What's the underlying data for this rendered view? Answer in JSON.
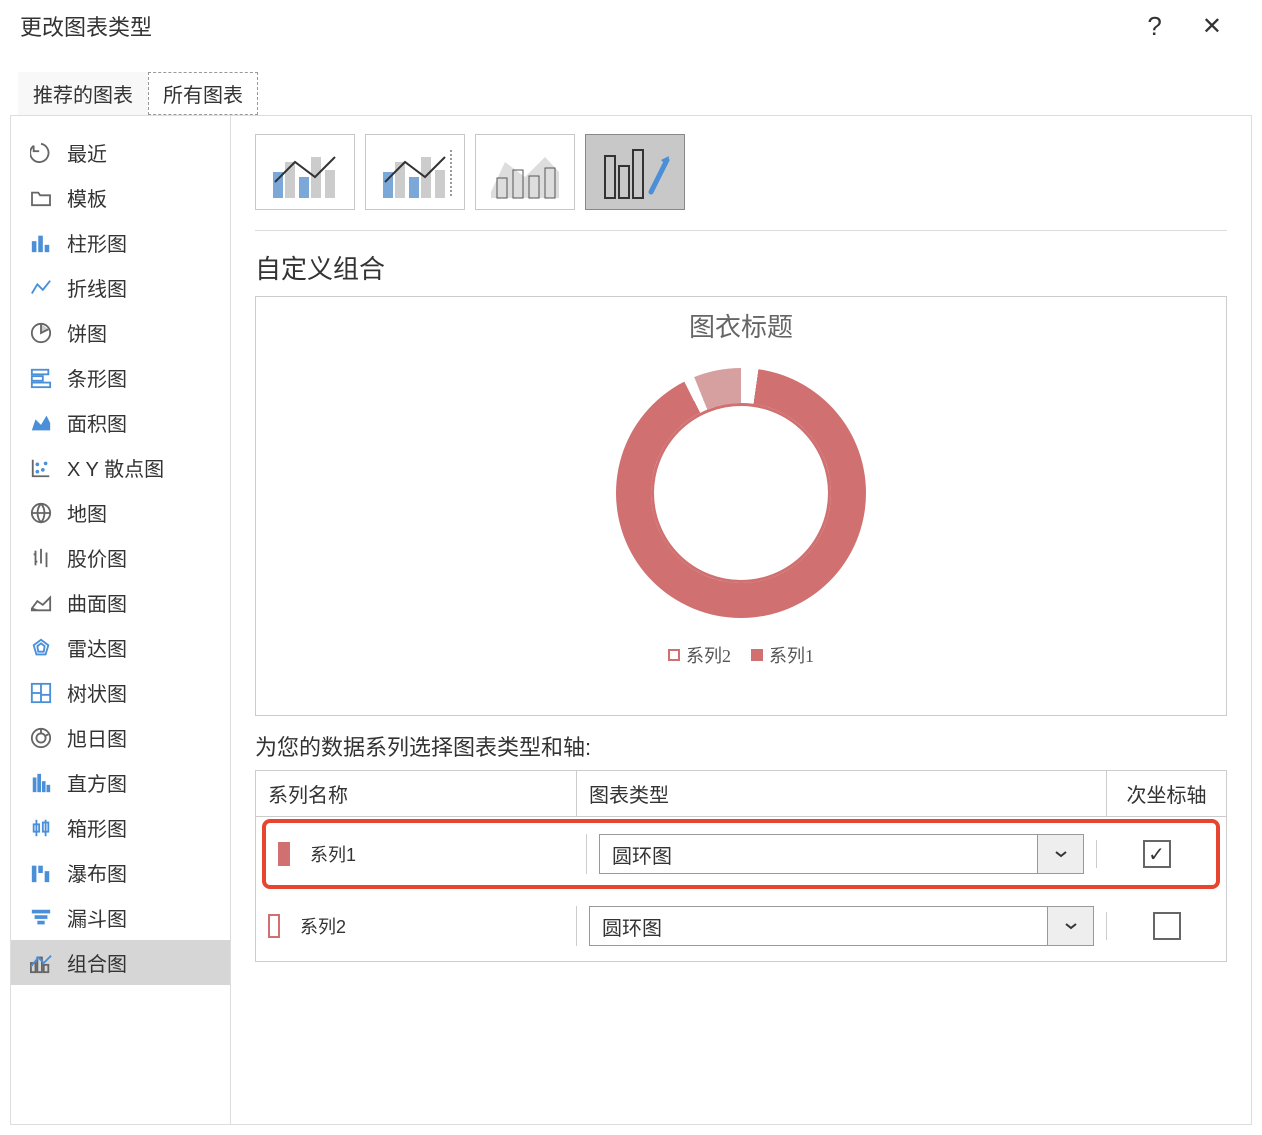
{
  "title": "更改图表类型",
  "help_label": "?",
  "close_label": "✕",
  "tabs": {
    "recommended": "推荐的图表",
    "all": "所有图表"
  },
  "sidebar": [
    {
      "label": "最近"
    },
    {
      "label": "模板"
    },
    {
      "label": "柱形图"
    },
    {
      "label": "折线图"
    },
    {
      "label": "饼图"
    },
    {
      "label": "条形图"
    },
    {
      "label": "面积图"
    },
    {
      "label": "X Y 散点图"
    },
    {
      "label": "地图"
    },
    {
      "label": "股价图"
    },
    {
      "label": "曲面图"
    },
    {
      "label": "雷达图"
    },
    {
      "label": "树状图"
    },
    {
      "label": "旭日图"
    },
    {
      "label": "直方图"
    },
    {
      "label": "箱形图"
    },
    {
      "label": "瀑布图"
    },
    {
      "label": "漏斗图"
    },
    {
      "label": "组合图"
    }
  ],
  "section_title": "自定义组合",
  "preview": {
    "title": "图衣标题",
    "legend": {
      "series2": "系列2",
      "series1": "系列1"
    }
  },
  "instruction": "为您的数据系列选择图表类型和轴:",
  "table": {
    "headers": {
      "name": "系列名称",
      "type": "图表类型",
      "axis": "次坐标轴"
    },
    "rows": [
      {
        "name": "系列1",
        "type": "圆环图",
        "checked": true,
        "color": "#d07070"
      },
      {
        "name": "系列2",
        "type": "圆环图",
        "checked": false,
        "color": "#ffffff"
      }
    ]
  }
}
